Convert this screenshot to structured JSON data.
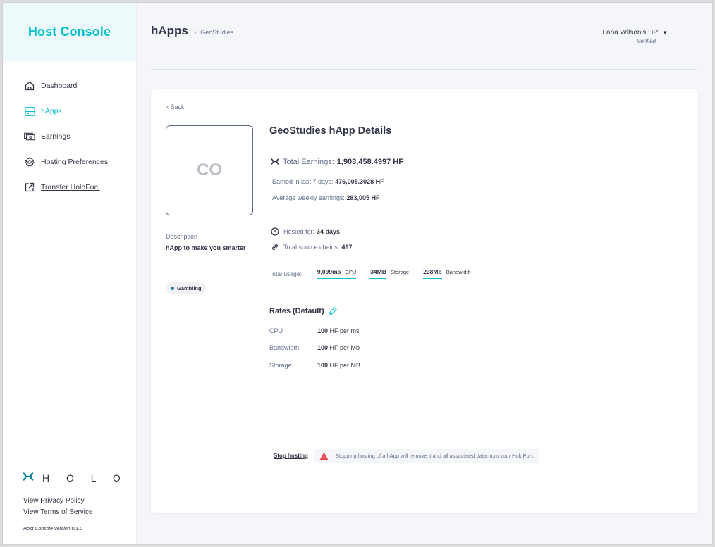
{
  "sidebar": {
    "brand": "Host Console",
    "items": [
      {
        "label": "Dashboard",
        "icon": "home-icon"
      },
      {
        "label": "hApps",
        "icon": "happs-icon"
      },
      {
        "label": "Earnings",
        "icon": "money-icon"
      },
      {
        "label": "Hosting Preferences",
        "icon": "gear-icon"
      },
      {
        "label": "Transfer HoloFuel",
        "icon": "external-link-icon"
      }
    ],
    "logo_text": "H O L O",
    "privacy_link": "View Privacy Policy",
    "terms_link": "View Terms of Service",
    "version": "Host Console version 0.1.0"
  },
  "header": {
    "title": "hApps",
    "breadcrumb_sep": "›",
    "breadcrumb": "GeoStudies",
    "user_name": "Lana Wilson's HP",
    "user_status": "Verified"
  },
  "detail": {
    "back": "‹  Back",
    "thumbnail_text": "CO",
    "description_label": "Description",
    "description_value": "hApp to make you smarter",
    "tag": "Gambling",
    "title": "GeoStudies hApp Details",
    "total_earnings_label": "Total Earnings:",
    "total_earnings_value": "1,903,458.4997 HF",
    "last7_label": "Earned in last 7 days:",
    "last7_value": "476,005.3028 HF",
    "weekly_label": "Average weekly earnings:",
    "weekly_value": "283,005 HF",
    "hosted_label": "Hosted for:",
    "hosted_value": "34 days",
    "chains_label": "Total source chains:",
    "chains_value": "497",
    "usage_label": "Total usage:",
    "usage": [
      {
        "value": "9,099ms",
        "unit": "CPU"
      },
      {
        "value": "34MB",
        "unit": "Storage"
      },
      {
        "value": "238Mb",
        "unit": "Bandwidth"
      }
    ],
    "rates_title": "Rates (Default)",
    "rates": [
      {
        "name": "CPU",
        "amount": "100",
        "unit": "HF per ms"
      },
      {
        "name": "Bandwidth",
        "amount": "100",
        "unit": "HF per Mb"
      },
      {
        "name": "Storage",
        "amount": "100",
        "unit": "HF per MB"
      }
    ],
    "stop_hosting": "Stop hosting",
    "warning": "Stopping hosting of a hApp will remove it and all associated data from your HoloPort."
  },
  "colors": {
    "accent": "#00bfcf",
    "text": "#313446",
    "muted": "#606c8b",
    "warning": "#e5484d",
    "tag_dot": "#1b7fa9"
  }
}
